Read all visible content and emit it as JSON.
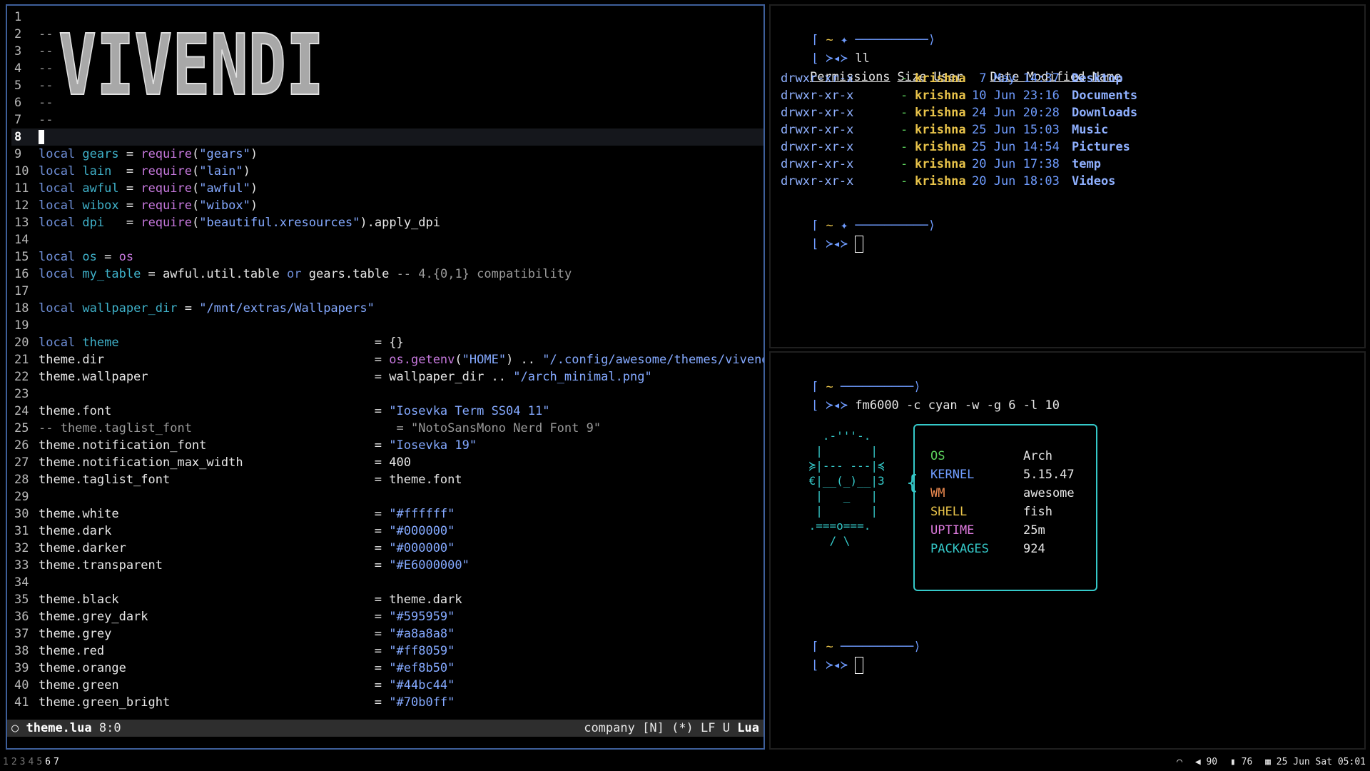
{
  "editor": {
    "banner_text": "VIVENDI",
    "lines": [
      {
        "n": "1",
        "tokens": []
      },
      {
        "n": "2",
        "tokens": [
          {
            "c": "cm",
            "t": "--"
          }
        ]
      },
      {
        "n": "3",
        "tokens": [
          {
            "c": "cm",
            "t": "--"
          }
        ]
      },
      {
        "n": "4",
        "tokens": [
          {
            "c": "cm",
            "t": "--"
          }
        ]
      },
      {
        "n": "5",
        "tokens": [
          {
            "c": "cm",
            "t": "--"
          }
        ]
      },
      {
        "n": "6",
        "tokens": [
          {
            "c": "cm",
            "t": "--"
          }
        ]
      },
      {
        "n": "7",
        "tokens": [
          {
            "c": "cm",
            "t": "--"
          }
        ]
      },
      {
        "n": "8",
        "tokens": [],
        "current": true
      },
      {
        "n": "9",
        "tokens": [
          {
            "c": "kw",
            "t": "local "
          },
          {
            "c": "var",
            "t": "gears"
          },
          {
            "c": "",
            "t": " = "
          },
          {
            "c": "fn",
            "t": "require"
          },
          {
            "c": "",
            "t": "("
          },
          {
            "c": "str",
            "t": "\"gears\""
          },
          {
            "c": "",
            "t": ")"
          }
        ]
      },
      {
        "n": "10",
        "tokens": [
          {
            "c": "kw",
            "t": "local "
          },
          {
            "c": "var",
            "t": "lain"
          },
          {
            "c": "",
            "t": "  = "
          },
          {
            "c": "fn",
            "t": "require"
          },
          {
            "c": "",
            "t": "("
          },
          {
            "c": "str",
            "t": "\"lain\""
          },
          {
            "c": "",
            "t": ")"
          }
        ]
      },
      {
        "n": "11",
        "tokens": [
          {
            "c": "kw",
            "t": "local "
          },
          {
            "c": "var",
            "t": "awful"
          },
          {
            "c": "",
            "t": " = "
          },
          {
            "c": "fn",
            "t": "require"
          },
          {
            "c": "",
            "t": "("
          },
          {
            "c": "str",
            "t": "\"awful\""
          },
          {
            "c": "",
            "t": ")"
          }
        ]
      },
      {
        "n": "12",
        "tokens": [
          {
            "c": "kw",
            "t": "local "
          },
          {
            "c": "var",
            "t": "wibox"
          },
          {
            "c": "",
            "t": " = "
          },
          {
            "c": "fn",
            "t": "require"
          },
          {
            "c": "",
            "t": "("
          },
          {
            "c": "str",
            "t": "\"wibox\""
          },
          {
            "c": "",
            "t": ")"
          }
        ]
      },
      {
        "n": "13",
        "tokens": [
          {
            "c": "kw",
            "t": "local "
          },
          {
            "c": "var",
            "t": "dpi"
          },
          {
            "c": "",
            "t": "   = "
          },
          {
            "c": "fn",
            "t": "require"
          },
          {
            "c": "",
            "t": "("
          },
          {
            "c": "str",
            "t": "\"beautiful.xresources\""
          },
          {
            "c": "",
            "t": ").apply_dpi"
          }
        ]
      },
      {
        "n": "14",
        "tokens": []
      },
      {
        "n": "15",
        "tokens": [
          {
            "c": "kw",
            "t": "local "
          },
          {
            "c": "var",
            "t": "os"
          },
          {
            "c": "",
            "t": " = "
          },
          {
            "c": "fn",
            "t": "os"
          }
        ]
      },
      {
        "n": "16",
        "tokens": [
          {
            "c": "kw",
            "t": "local "
          },
          {
            "c": "var",
            "t": "my_table"
          },
          {
            "c": "",
            "t": " = awful.util.table "
          },
          {
            "c": "kw",
            "t": "or"
          },
          {
            "c": "",
            "t": " gears.table "
          },
          {
            "c": "cm",
            "t": "-- 4.{0,1} compatibility"
          }
        ]
      },
      {
        "n": "17",
        "tokens": []
      },
      {
        "n": "18",
        "tokens": [
          {
            "c": "kw",
            "t": "local "
          },
          {
            "c": "var",
            "t": "wallpaper_dir"
          },
          {
            "c": "",
            "t": " = "
          },
          {
            "c": "str",
            "t": "\"/mnt/extras/Wallpapers\""
          }
        ]
      },
      {
        "n": "19",
        "tokens": []
      },
      {
        "n": "20",
        "tokens": [
          {
            "c": "kw",
            "t": "local "
          },
          {
            "c": "var",
            "t": "theme"
          },
          {
            "c": "",
            "t": "                                   = {}"
          }
        ]
      },
      {
        "n": "21",
        "tokens": [
          {
            "c": "",
            "t": "theme.dir                                     = "
          },
          {
            "c": "fn",
            "t": "os.getenv"
          },
          {
            "c": "",
            "t": "("
          },
          {
            "c": "str",
            "t": "\"HOME\""
          },
          {
            "c": "",
            "t": ") .. "
          },
          {
            "c": "str",
            "t": "\"/.config/awesome/themes/vivendi\""
          }
        ]
      },
      {
        "n": "22",
        "tokens": [
          {
            "c": "",
            "t": "theme.wallpaper                               = wallpaper_dir .. "
          },
          {
            "c": "str",
            "t": "\"/arch_minimal.png\""
          }
        ]
      },
      {
        "n": "23",
        "tokens": []
      },
      {
        "n": "24",
        "tokens": [
          {
            "c": "",
            "t": "theme.font                                    = "
          },
          {
            "c": "str",
            "t": "\"Iosevka Term SS04 11\""
          }
        ]
      },
      {
        "n": "25",
        "tokens": [
          {
            "c": "cm",
            "t": "-- theme.taglist_font                            = \"NotoSansMono Nerd Font 9\""
          }
        ]
      },
      {
        "n": "26",
        "tokens": [
          {
            "c": "",
            "t": "theme.notification_font                       = "
          },
          {
            "c": "str",
            "t": "\"Iosevka 19\""
          }
        ]
      },
      {
        "n": "27",
        "tokens": [
          {
            "c": "",
            "t": "theme.notification_max_width                  = 400"
          }
        ]
      },
      {
        "n": "28",
        "tokens": [
          {
            "c": "",
            "t": "theme.taglist_font                            = theme.font"
          }
        ]
      },
      {
        "n": "29",
        "tokens": []
      },
      {
        "n": "30",
        "tokens": [
          {
            "c": "",
            "t": "theme.white                                   = "
          },
          {
            "c": "str",
            "t": "\"#ffffff\""
          }
        ]
      },
      {
        "n": "31",
        "tokens": [
          {
            "c": "",
            "t": "theme.dark                                    = "
          },
          {
            "c": "str",
            "t": "\"#000000\""
          }
        ]
      },
      {
        "n": "32",
        "tokens": [
          {
            "c": "",
            "t": "theme.darker                                  = "
          },
          {
            "c": "str",
            "t": "\"#000000\""
          }
        ]
      },
      {
        "n": "33",
        "tokens": [
          {
            "c": "",
            "t": "theme.transparent                             = "
          },
          {
            "c": "str",
            "t": "\"#E6000000\""
          }
        ]
      },
      {
        "n": "34",
        "tokens": []
      },
      {
        "n": "35",
        "tokens": [
          {
            "c": "",
            "t": "theme.black                                   = theme.dark"
          }
        ]
      },
      {
        "n": "36",
        "tokens": [
          {
            "c": "",
            "t": "theme.grey_dark                               = "
          },
          {
            "c": "str",
            "t": "\"#595959\""
          }
        ]
      },
      {
        "n": "37",
        "tokens": [
          {
            "c": "",
            "t": "theme.grey                                    = "
          },
          {
            "c": "str",
            "t": "\"#a8a8a8\""
          }
        ]
      },
      {
        "n": "38",
        "tokens": [
          {
            "c": "",
            "t": "theme.red                                     = "
          },
          {
            "c": "str",
            "t": "\"#ff8059\""
          }
        ]
      },
      {
        "n": "39",
        "tokens": [
          {
            "c": "",
            "t": "theme.orange                                  = "
          },
          {
            "c": "str",
            "t": "\"#ef8b50\""
          }
        ]
      },
      {
        "n": "40",
        "tokens": [
          {
            "c": "",
            "t": "theme.green                                   = "
          },
          {
            "c": "str",
            "t": "\"#44bc44\""
          }
        ]
      },
      {
        "n": "41",
        "tokens": [
          {
            "c": "",
            "t": "theme.green_bright                            = "
          },
          {
            "c": "str",
            "t": "\"#70b0ff\""
          }
        ]
      }
    ],
    "status": {
      "left_icon": "○",
      "filename": "theme.lua",
      "position": "8:0",
      "company": "company",
      "mode": "[N]",
      "modified": "(*)",
      "eol": "LF",
      "encoding": "U",
      "filetype": "Lua"
    }
  },
  "term_top": {
    "prompt_dir": "~",
    "prompt_icon": "✦",
    "command": "ll",
    "headers": [
      "Permissions",
      "Size",
      "User",
      "Date Modified",
      "Name"
    ],
    "rows": [
      {
        "perm": "drwxr-xr-x",
        "size": "-",
        "user": "krishna",
        "date": " 7 May 14:37",
        "name": "Desktop"
      },
      {
        "perm": "drwxr-xr-x",
        "size": "-",
        "user": "krishna",
        "date": "10 Jun 23:16",
        "name": "Documents"
      },
      {
        "perm": "drwxr-xr-x",
        "size": "-",
        "user": "krishna",
        "date": "24 Jun 20:28",
        "name": "Downloads"
      },
      {
        "perm": "drwxr-xr-x",
        "size": "-",
        "user": "krishna",
        "date": "25 Jun 15:03",
        "name": "Music"
      },
      {
        "perm": "drwxr-xr-x",
        "size": "-",
        "user": "krishna",
        "date": "25 Jun 14:54",
        "name": "Pictures"
      },
      {
        "perm": "drwxr-xr-x",
        "size": "-",
        "user": "krishna",
        "date": "20 Jun 17:38",
        "name": "temp"
      },
      {
        "perm": "drwxr-xr-x",
        "size": "-",
        "user": "krishna",
        "date": "20 Jun 18:03",
        "name": "Videos"
      }
    ]
  },
  "term_bottom": {
    "prompt_dir": "~",
    "command": "fm6000 -c cyan -w -g 6 -l 10",
    "info": [
      {
        "k": "OS",
        "v": "Arch",
        "color": "#5dd35d"
      },
      {
        "k": "KERNEL",
        "v": "5.15.47",
        "color": "#6f9cff"
      },
      {
        "k": "WM",
        "v": "awesome",
        "color": "#ef8b50"
      },
      {
        "k": "SHELL",
        "v": "fish",
        "color": "#e8c34a"
      },
      {
        "k": "UPTIME",
        "v": "25m",
        "color": "#e07be0"
      },
      {
        "k": "PACKAGES",
        "v": "924",
        "color": "#35c9c9"
      }
    ]
  },
  "bar": {
    "tags": [
      "1",
      "2",
      "3",
      "4",
      "5",
      "6",
      "7"
    ],
    "active_tags": [
      "6",
      "7"
    ],
    "volume": "90",
    "battery": "76",
    "datetime": "25 Jun Sat 05:01"
  }
}
